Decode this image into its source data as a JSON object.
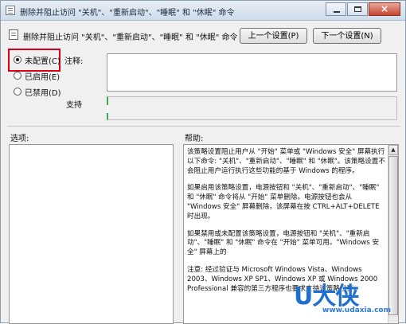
{
  "window": {
    "title": "删除并阻止访问 \"关机\"、\"重新启动\"、\"睡眠\" 和 \"休眠\" 命令",
    "buttons": {
      "minimize": "minimize-icon",
      "maximize": "maximize-icon",
      "close": "×"
    }
  },
  "header": {
    "policy_title": "删除并阻止访问 \"关机\"、\"重新启动\"、\"睡眠\" 和 \"休眠\" 命令",
    "prev_button": "上一个设置(P)",
    "next_button": "下一个设置(N)"
  },
  "radios": [
    {
      "label": "未配置(C)",
      "selected": true
    },
    {
      "label": "已启用(E)",
      "selected": false
    },
    {
      "label": "已禁用(D)",
      "selected": false
    }
  ],
  "highlight_color": "#d6001c",
  "labels": {
    "comment": "注释:",
    "support": "支持",
    "options": "选项:",
    "help": "帮助:"
  },
  "help_text": [
    "该策略设置阻止用户从 \"开始\" 菜单或 \"Windows 安全\" 屏幕执行以下命令: \"关机\"、\"重新启动\"、\"睡眠\" 和 \"休眠\"。该策略设置不会阻止用户运行执行这些功能的基于 Windows 的程序。",
    "如果启用该策略设置，电源按钮和 \"关机\"、\"重新启动\"、\"睡眠\" 和 \"休眠\" 命令将从 \"开始\" 菜单删除。电源按钮也会从 \"Windows 安全\" 屏幕删除，该屏幕在按 CTRL+ALT+DELETE 时出现。",
    "如果禁用或未配置该策略设置，电源按钮和 \"关机\"、\"重新启动\"、\"睡眠\" 和 \"休眠\" 命令在 \"开始\" 菜单可用。\"Windows 安全\" 屏幕上的",
    "注意: 经过验证与 Microsoft Windows Vista、Windows 2003、Windows XP SP1、Windows XP 或 Windows 2000 Professional 兼容的第三方程序也要求支持该策略设置。"
  ],
  "watermark": {
    "big": "U大侠",
    "small": "www.udaxia.com"
  }
}
